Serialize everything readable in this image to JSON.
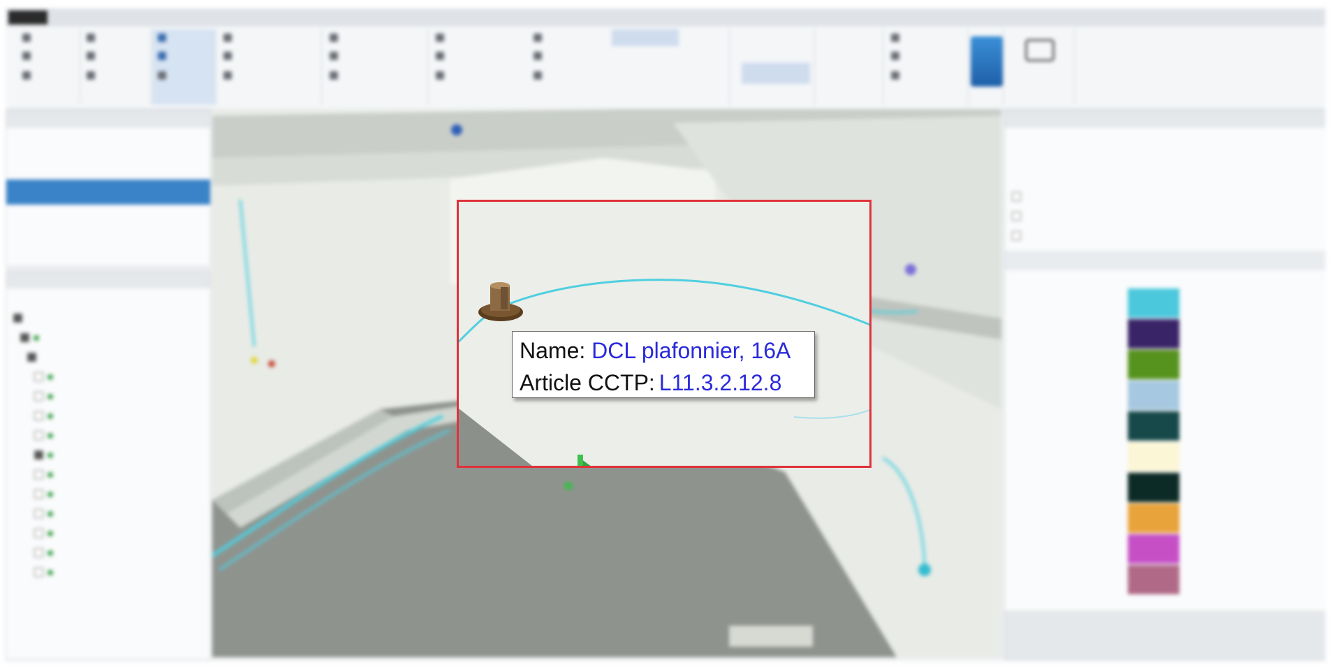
{
  "tooltip": {
    "name_label": "Name:",
    "name_value": "DCL plafonnier, 16A",
    "article_label": "Article CCTP:",
    "article_value": "L11.3.2.12.8"
  },
  "colors": {
    "inset_border": "#e0323a",
    "tooltip_value": "#2a2adb",
    "pipe": "#4fcfe0",
    "swatches": [
      "#4bc8dc",
      "#3a2468",
      "#56921e",
      "#a6c8e0",
      "#17494a",
      "#fbf6d6",
      "#0c2a26",
      "#e9a33b",
      "#c64fc6",
      "#b06a88"
    ]
  },
  "icons": [
    "lamp-fixture-icon",
    "orange-marker-icon",
    "green-arrow-icon"
  ]
}
